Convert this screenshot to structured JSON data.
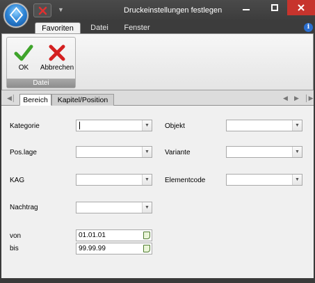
{
  "window": {
    "title": "Druckeinstellungen festlegen",
    "minimize_glyph": "—",
    "close_color": "#c7342d"
  },
  "ribbon": {
    "tabs": [
      "Favoriten",
      "Datei",
      "Fenster"
    ],
    "active_tab": "Favoriten",
    "help_glyph": "i",
    "group": {
      "label": "Datei",
      "buttons": [
        {
          "label": "OK",
          "icon": "checkmark-icon"
        },
        {
          "label": "Abbrechen",
          "icon": "red-x-icon"
        }
      ]
    }
  },
  "content_tabs": [
    "Bereich",
    "Kapitel/Position"
  ],
  "active_content_tab": "Bereich",
  "form": {
    "kategorie_label": "Kategorie",
    "kategorie_value": "",
    "poslage_label": "Pos.lage",
    "poslage_value": "",
    "kag_label": "KAG",
    "kag_value": "",
    "nachtrag_label": "Nachtrag",
    "nachtrag_value": "",
    "objekt_label": "Objekt",
    "objekt_value": "",
    "variante_label": "Variante",
    "variante_value": "",
    "elementcode_label": "Elementcode",
    "elementcode_value": "",
    "von_label": "von",
    "von_value": "01.01.01",
    "bis_label": "bis",
    "bis_value": "99.99.99"
  },
  "colors": {
    "accent": "#2f86d6",
    "ok_green": "#3fa42b",
    "cancel_red": "#d42020"
  }
}
